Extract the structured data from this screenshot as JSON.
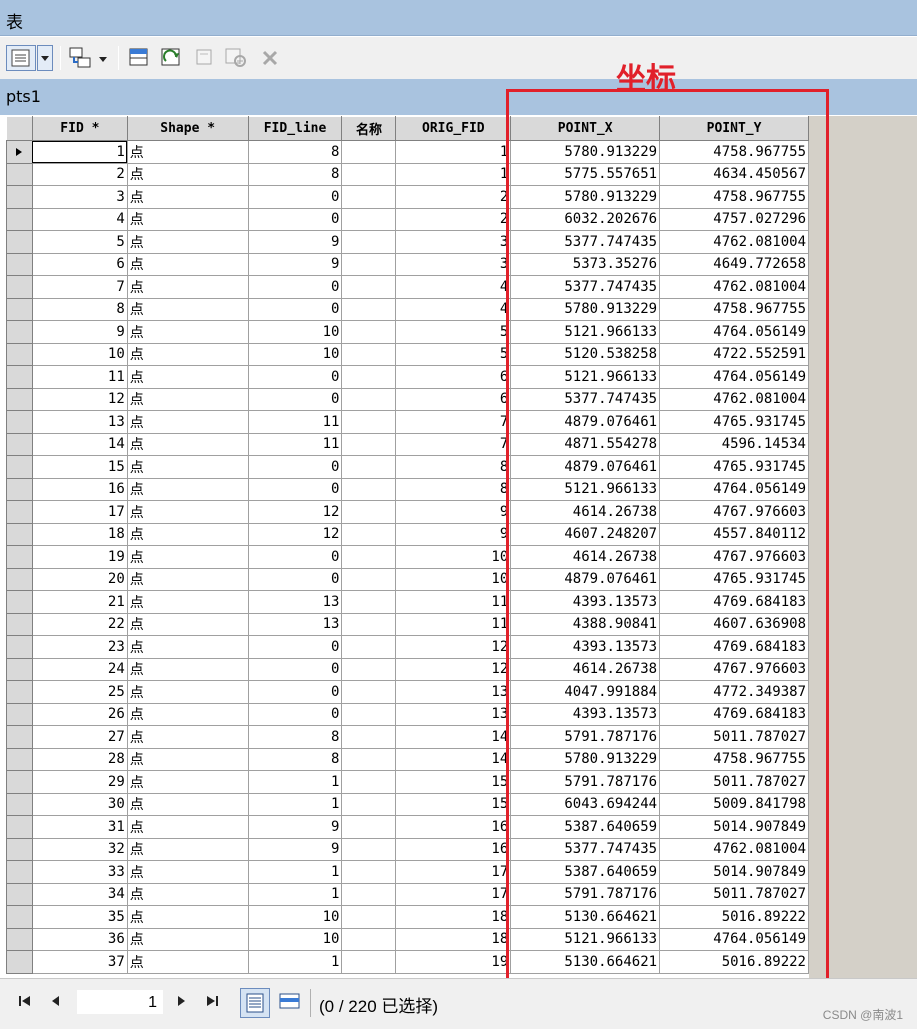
{
  "window": {
    "title": "表"
  },
  "tab": {
    "name": "pts1"
  },
  "toolbar": {
    "icons": [
      "table-options-icon",
      "dropdown-icon",
      "related-tables-icon",
      "dropdown-icon",
      "select-by-attributes-icon",
      "switch-selection-icon",
      "clear-selection-icon",
      "zoom-to-selected-icon",
      "delete-selected-icon"
    ]
  },
  "annotation": {
    "label": "坐标",
    "color": "#e1202a"
  },
  "columns": [
    "FID *",
    "Shape *",
    "FID_line",
    "名称",
    "ORIG_FID",
    "POINT_X",
    "POINT_Y"
  ],
  "rows": [
    [
      "1",
      "点",
      "8",
      "",
      "1",
      "5780.913229",
      "4758.967755"
    ],
    [
      "2",
      "点",
      "8",
      "",
      "1",
      "5775.557651",
      "4634.450567"
    ],
    [
      "3",
      "点",
      "0",
      "",
      "2",
      "5780.913229",
      "4758.967755"
    ],
    [
      "4",
      "点",
      "0",
      "",
      "2",
      "6032.202676",
      "4757.027296"
    ],
    [
      "5",
      "点",
      "9",
      "",
      "3",
      "5377.747435",
      "4762.081004"
    ],
    [
      "6",
      "点",
      "9",
      "",
      "3",
      "5373.35276",
      "4649.772658"
    ],
    [
      "7",
      "点",
      "0",
      "",
      "4",
      "5377.747435",
      "4762.081004"
    ],
    [
      "8",
      "点",
      "0",
      "",
      "4",
      "5780.913229",
      "4758.967755"
    ],
    [
      "9",
      "点",
      "10",
      "",
      "5",
      "5121.966133",
      "4764.056149"
    ],
    [
      "10",
      "点",
      "10",
      "",
      "5",
      "5120.538258",
      "4722.552591"
    ],
    [
      "11",
      "点",
      "0",
      "",
      "6",
      "5121.966133",
      "4764.056149"
    ],
    [
      "12",
      "点",
      "0",
      "",
      "6",
      "5377.747435",
      "4762.081004"
    ],
    [
      "13",
      "点",
      "11",
      "",
      "7",
      "4879.076461",
      "4765.931745"
    ],
    [
      "14",
      "点",
      "11",
      "",
      "7",
      "4871.554278",
      "4596.14534"
    ],
    [
      "15",
      "点",
      "0",
      "",
      "8",
      "4879.076461",
      "4765.931745"
    ],
    [
      "16",
      "点",
      "0",
      "",
      "8",
      "5121.966133",
      "4764.056149"
    ],
    [
      "17",
      "点",
      "12",
      "",
      "9",
      "4614.26738",
      "4767.976603"
    ],
    [
      "18",
      "点",
      "12",
      "",
      "9",
      "4607.248207",
      "4557.840112"
    ],
    [
      "19",
      "点",
      "0",
      "",
      "10",
      "4614.26738",
      "4767.976603"
    ],
    [
      "20",
      "点",
      "0",
      "",
      "10",
      "4879.076461",
      "4765.931745"
    ],
    [
      "21",
      "点",
      "13",
      "",
      "11",
      "4393.13573",
      "4769.684183"
    ],
    [
      "22",
      "点",
      "13",
      "",
      "11",
      "4388.90841",
      "4607.636908"
    ],
    [
      "23",
      "点",
      "0",
      "",
      "12",
      "4393.13573",
      "4769.684183"
    ],
    [
      "24",
      "点",
      "0",
      "",
      "12",
      "4614.26738",
      "4767.976603"
    ],
    [
      "25",
      "点",
      "0",
      "",
      "13",
      "4047.991884",
      "4772.349387"
    ],
    [
      "26",
      "点",
      "0",
      "",
      "13",
      "4393.13573",
      "4769.684183"
    ],
    [
      "27",
      "点",
      "8",
      "",
      "14",
      "5791.787176",
      "5011.787027"
    ],
    [
      "28",
      "点",
      "8",
      "",
      "14",
      "5780.913229",
      "4758.967755"
    ],
    [
      "29",
      "点",
      "1",
      "",
      "15",
      "5791.787176",
      "5011.787027"
    ],
    [
      "30",
      "点",
      "1",
      "",
      "15",
      "6043.694244",
      "5009.841798"
    ],
    [
      "31",
      "点",
      "9",
      "",
      "16",
      "5387.640659",
      "5014.907849"
    ],
    [
      "32",
      "点",
      "9",
      "",
      "16",
      "5377.747435",
      "4762.081004"
    ],
    [
      "33",
      "点",
      "1",
      "",
      "17",
      "5387.640659",
      "5014.907849"
    ],
    [
      "34",
      "点",
      "1",
      "",
      "17",
      "5791.787176",
      "5011.787027"
    ],
    [
      "35",
      "点",
      "10",
      "",
      "18",
      "5130.664621",
      "5016.89222"
    ],
    [
      "36",
      "点",
      "10",
      "",
      "18",
      "5121.966133",
      "4764.056149"
    ],
    [
      "37",
      "点",
      "1",
      "",
      "19",
      "5130.664621",
      "5016.89222"
    ]
  ],
  "status": {
    "page_value": "1",
    "selection_text": "(0 / 220 已选择)"
  },
  "watermark": "CSDN @南波1"
}
